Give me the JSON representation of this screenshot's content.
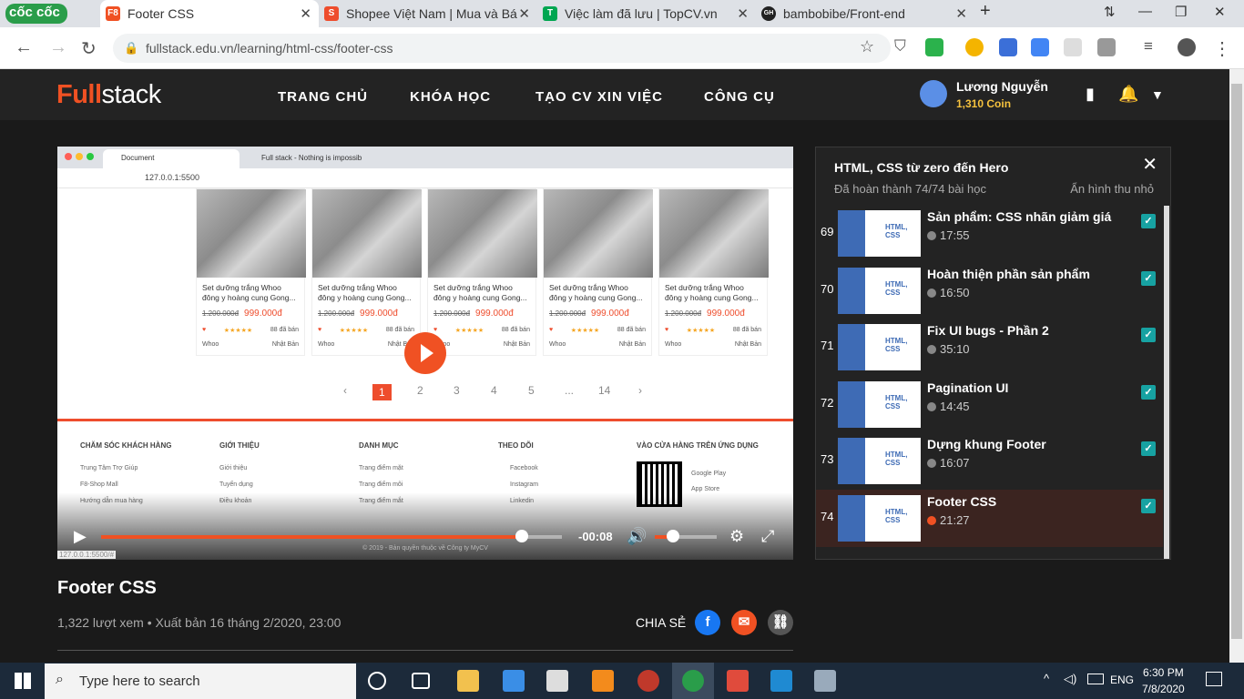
{
  "browser": {
    "logo": "cốc cốc",
    "tabs": [
      {
        "label": "Footer CSS",
        "icon": "F8"
      },
      {
        "label": "Shopee Việt Nam | Mua và Bá",
        "icon": "S"
      },
      {
        "label": "Việc làm đã lưu | TopCV.vn",
        "icon": "T"
      },
      {
        "label": "bambobibe/Front-end",
        "icon": "GH"
      }
    ],
    "url": "fullstack.edu.vn/learning/html-css/footer-css"
  },
  "site": {
    "brand_a": "Full",
    "brand_b": "stack",
    "menu": [
      "TRANG CHỦ",
      "KHÓA HỌC",
      "TẠO CV XIN VIỆC",
      "CÔNG CỤ"
    ],
    "user": "Lương Nguyễn",
    "coin": "1,310 Coin"
  },
  "video": {
    "inner_tabs": [
      "Document",
      "Full stack - Nothing is impossib"
    ],
    "inner_url": "127.0.0.1:5500",
    "products": [
      {
        "name": "Set dưỡng trắng Whoo đông y hoàng cung Gong...",
        "old": "1.200.000đ",
        "price": "999.000đ",
        "sold": "88 đã bán",
        "brand": "Whoo",
        "origin": "Nhật Bản"
      },
      {
        "name": "Set dưỡng trắng Whoo đông y hoàng cung Gong...",
        "old": "1.200.000đ",
        "price": "999.000đ",
        "sold": "88 đã bán",
        "brand": "Whoo",
        "origin": "Nhật Bản"
      },
      {
        "name": "Set dưỡng trắng Whoo đông y hoàng cung Gong...",
        "old": "1.200.000đ",
        "price": "999.000đ",
        "sold": "88 đã bán",
        "brand": "Whoo",
        "origin": "Nhật Bản"
      },
      {
        "name": "Set dưỡng trắng Whoo đông y hoàng cung Gong...",
        "old": "1.200.000đ",
        "price": "999.000đ",
        "sold": "88 đã bán",
        "brand": "Whoo",
        "origin": "Nhật Bản"
      },
      {
        "name": "Set dưỡng trắng Whoo đông y hoàng cung Gong...",
        "old": "1.200.000đ",
        "price": "999.000đ",
        "sold": "88 đã bán",
        "brand": "Whoo",
        "origin": "Nhật Bản"
      }
    ],
    "pages": [
      "1",
      "2",
      "3",
      "4",
      "5",
      "...",
      "14"
    ],
    "footer_cols": [
      {
        "title": "CHĂM SÓC KHÁCH HÀNG",
        "items": [
          "Trung Tâm Trợ Giúp",
          "F8-Shop Mall",
          "Hướng dẫn mua hàng"
        ]
      },
      {
        "title": "GIỚI THIỆU",
        "items": [
          "Giới thiệu",
          "Tuyển dụng",
          "Điều khoản"
        ]
      },
      {
        "title": "DANH MỤC",
        "items": [
          "Trang điểm mặt",
          "Trang điểm môi",
          "Trang điểm mắt"
        ]
      },
      {
        "title": "THEO DÕI",
        "items": [
          "Facebook",
          "Instagram",
          "Linkedin"
        ]
      },
      {
        "title": "VÀO CỬA HÀNG TRÊN ỨNG DỤNG",
        "items": [
          "Google Play",
          "App Store"
        ]
      }
    ],
    "copyright": "© 2019 - Bản quyền thuộc về Công ty MyCV",
    "status_url": "127.0.0.1:5500/#",
    "time": "-00:08",
    "progress": 0.9,
    "volume": 0.3
  },
  "lesson": {
    "title": "Footer CSS",
    "meta": "1,322 lượt xem • Xuất bản 16 tháng 2/2020, 23:00",
    "share": "CHIA SẺ"
  },
  "panel": {
    "title": "HTML, CSS từ zero đến Hero",
    "progress": "Đã hoàn thành 74/74 bài học",
    "hide": "Ẩn hình thu nhỏ",
    "lessons": [
      {
        "num": "69",
        "name": "Sản phẩm: CSS nhãn giảm giá",
        "dur": "17:55"
      },
      {
        "num": "70",
        "name": "Hoàn thiện phần sản phẩm",
        "dur": "16:50"
      },
      {
        "num": "71",
        "name": "Fix UI bugs - Phần 2",
        "dur": "35:10"
      },
      {
        "num": "72",
        "name": "Pagination UI",
        "dur": "14:45"
      },
      {
        "num": "73",
        "name": "Dựng khung Footer",
        "dur": "16:07"
      },
      {
        "num": "74",
        "name": "Footer CSS",
        "dur": "21:27"
      }
    ]
  },
  "taskbar": {
    "search": "Type here to search",
    "lang": "ENG",
    "time": "6:30 PM",
    "date": "7/8/2020"
  },
  "colors": {
    "accent": "#f05123",
    "check": "#17a2a2",
    "coin": "#f6c23e"
  }
}
